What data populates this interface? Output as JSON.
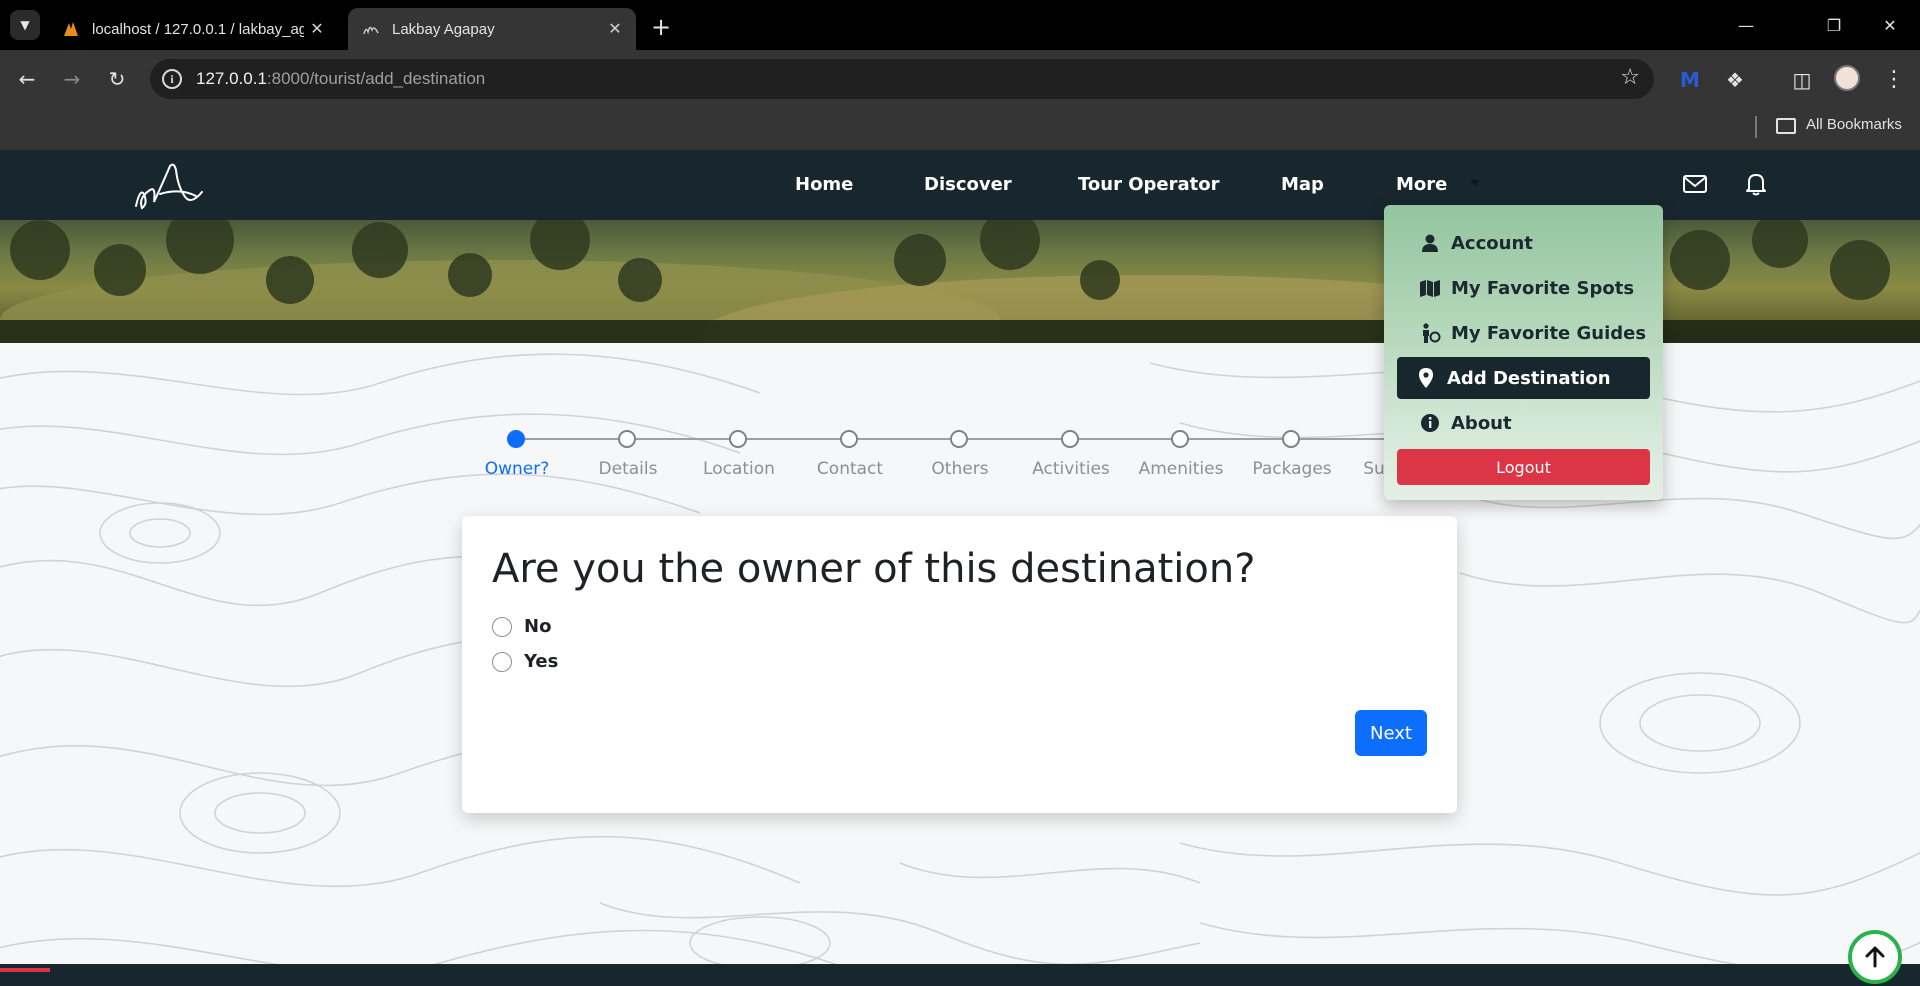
{
  "browser": {
    "tabs": [
      {
        "title": "localhost / 127.0.0.1 / lakbay_ag",
        "active": false
      },
      {
        "title": "Lakbay Agapay",
        "active": true
      }
    ],
    "url_host": "127.0.0.1",
    "url_rest": ":8000/tourist/add_destination",
    "bookmarks_label": "All Bookmarks"
  },
  "navbar": {
    "links": [
      "Home",
      "Discover",
      "Tour Operator",
      "Map",
      "More"
    ]
  },
  "dropdown": {
    "items": [
      {
        "label": "Account",
        "icon": "user-icon"
      },
      {
        "label": "My Favorite Spots",
        "icon": "map-icon"
      },
      {
        "label": "My Favorite Guides",
        "icon": "guide-icon"
      },
      {
        "label": "Add Destination",
        "icon": "location-pin-icon",
        "active": true
      },
      {
        "label": "About",
        "icon": "info-icon"
      }
    ],
    "logout_label": "Logout"
  },
  "stepper": {
    "steps": [
      "Owner?",
      "Details",
      "Location",
      "Contact",
      "Others",
      "Activities",
      "Amenities",
      "Packages",
      "Su"
    ],
    "active_index": 0
  },
  "form": {
    "question": "Are you the owner of this destination?",
    "options": [
      "No",
      "Yes"
    ],
    "next_label": "Next"
  },
  "colors": {
    "navbar": "#18262e",
    "accent": "#0d6efd",
    "danger": "#dc3545"
  }
}
